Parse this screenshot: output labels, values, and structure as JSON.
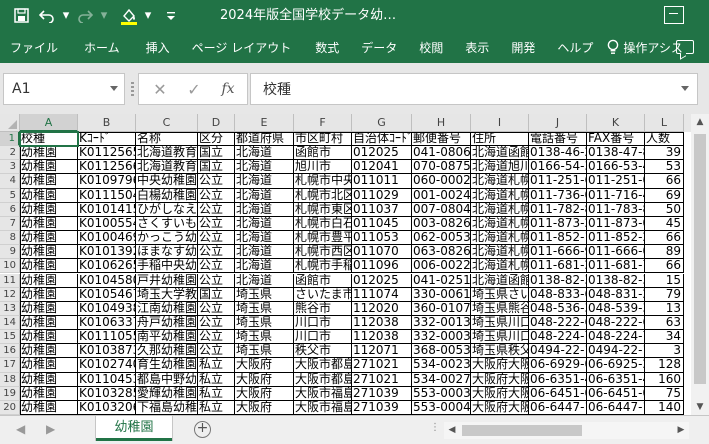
{
  "titlebar": {
    "title": "2024年版全国学校データ幼…",
    "qat": [
      "save-icon",
      "undo-icon",
      "redo-icon",
      "fill-color-icon",
      "customize-icon"
    ]
  },
  "ribbon": {
    "tabs": [
      "ファイル",
      "ホーム",
      "挿入",
      "ページ レイアウト",
      "数式",
      "データ",
      "校閲",
      "表示",
      "開発",
      "ヘルプ"
    ],
    "tell_me": "操作アシス"
  },
  "formula_bar": {
    "name_box": "A1",
    "cancel": "✕",
    "confirm": "✓",
    "fx": "fx",
    "value": "校種"
  },
  "sheet": {
    "columns": [
      "A",
      "B",
      "C",
      "D",
      "E",
      "F",
      "G",
      "H",
      "I",
      "J",
      "K",
      "L"
    ],
    "rows": [
      {
        "n": "1",
        "cells": [
          "校種",
          "Kｺｰﾄﾞ",
          "名称",
          "区分",
          "都道府県",
          "市区町村",
          "自治体ｺｰﾄﾞ",
          "郵便番号",
          "住所",
          "電話番号",
          "FAX番号",
          "人数"
        ]
      },
      {
        "n": "2",
        "cells": [
          "幼稚園",
          "K01125658",
          "北海道教育",
          "国立",
          "北海道",
          "函館市",
          "012025",
          "041-0806",
          "北海道函館",
          "0138-46-2",
          "0138-47-8",
          "39"
        ]
      },
      {
        "n": "3",
        "cells": [
          "幼稚園",
          "K01125669",
          "北海道教育",
          "国立",
          "北海道",
          "旭川市",
          "012041",
          "070-0875",
          "北海道旭川",
          "0166-54-3",
          "0166-53-4",
          "53"
        ]
      },
      {
        "n": "4",
        "cells": [
          "幼稚園",
          "K01097960",
          "中央幼稚園",
          "公立",
          "北海道",
          "札幌市中央",
          "011011",
          "060-0002",
          "北海道札幌",
          "011-251-6",
          "011-251-0",
          "66"
        ]
      },
      {
        "n": "5",
        "cells": [
          "幼稚園",
          "K01115046",
          "白楊幼稚園",
          "公立",
          "北海道",
          "札幌市北区",
          "011029",
          "001-0024",
          "北海道札幌",
          "011-736-0",
          "011-716-4",
          "69"
        ]
      },
      {
        "n": "6",
        "cells": [
          "幼稚園",
          "K01014158",
          "ひがしなえ",
          "公立",
          "北海道",
          "札幌市東区",
          "011037",
          "007-0804",
          "北海道札幌",
          "011-782-8",
          "011-783-8",
          "50"
        ]
      },
      {
        "n": "7",
        "cells": [
          "幼稚園",
          "K01005547",
          "さくすいもと",
          "公立",
          "北海道",
          "札幌市白石",
          "011045",
          "003-0826",
          "北海道札幌",
          "011-873-2",
          "011-873-0",
          "45"
        ]
      },
      {
        "n": "8",
        "cells": [
          "幼稚園",
          "K01004694",
          "かっこう幼稚",
          "公立",
          "北海道",
          "札幌市豊平",
          "011053",
          "062-0053",
          "北海道札幌",
          "011-852-1",
          "011-852-2",
          "66"
        ]
      },
      {
        "n": "9",
        "cells": [
          "幼稚園",
          "K01013928",
          "ほまなす幼",
          "公立",
          "北海道",
          "札幌市西区",
          "011070",
          "063-0826",
          "北海道札幌",
          "011-666-9",
          "011-666-0",
          "89"
        ]
      },
      {
        "n": "10",
        "cells": [
          "幼稚園",
          "K01062656",
          "手稲中央幼",
          "公立",
          "北海道",
          "札幌市手稲",
          "011096",
          "006-0022",
          "北海道札幌",
          "011-681-2",
          "011-681-7",
          "66"
        ]
      },
      {
        "n": "11",
        "cells": [
          "幼稚園",
          "K01045804",
          "戸井幼稚園",
          "公立",
          "北海道",
          "函館市",
          "012025",
          "041-0251",
          "北海道函館",
          "0138-82-3",
          "0138-82-3",
          "15"
        ]
      },
      {
        "n": "12",
        "cells": [
          "幼稚園",
          "K01054677",
          "埼玉大学教",
          "国立",
          "埼玉県",
          "さいたま市",
          "111074",
          "330-0061",
          "埼玉県さい",
          "048-833-6",
          "048-831-2",
          "79"
        ]
      },
      {
        "n": "13",
        "cells": [
          "幼稚園",
          "K01049381",
          "江南幼稚園",
          "公立",
          "埼玉県",
          "熊谷市",
          "112020",
          "360-0107",
          "埼玉県熊谷",
          "048-536-3",
          "048-539-3",
          "13"
        ]
      },
      {
        "n": "14",
        "cells": [
          "幼稚園",
          "K01063370",
          "舟戸幼稚園",
          "公立",
          "埼玉県",
          "川口市",
          "112038",
          "332-0013",
          "埼玉県川口",
          "048-222-6",
          "048-222-6",
          "63"
        ]
      },
      {
        "n": "15",
        "cells": [
          "幼稚園",
          "K01110557",
          "南平幼稚園",
          "公立",
          "埼玉県",
          "川口市",
          "112038",
          "332-0003",
          "埼玉県川口",
          "048-224-7",
          "048-224-7",
          "34"
        ]
      },
      {
        "n": "16",
        "cells": [
          "幼稚園",
          "K01038734",
          "久那幼稚園",
          "公立",
          "埼玉県",
          "秩父市",
          "112071",
          "368-0053",
          "埼玉県秩父",
          "0494-22-1",
          "0494-22-1",
          "3"
        ]
      },
      {
        "n": "17",
        "cells": [
          "幼稚園",
          "K01027408",
          "育生幼稚園",
          "私立",
          "大阪府",
          "大阪市都島",
          "271021",
          "534-0023",
          "大阪府大阪",
          "06-6929-0",
          "06-6925-2",
          "128"
        ]
      },
      {
        "n": "18",
        "cells": [
          "幼稚園",
          "K01104536",
          "都島中野幼",
          "私立",
          "大阪府",
          "大阪市都島",
          "271021",
          "534-0027",
          "大阪府大阪",
          "06-6351-4",
          "06-6351-4",
          "160"
        ]
      },
      {
        "n": "19",
        "cells": [
          "幼稚園",
          "K01032851",
          "愛輝幼稚園",
          "私立",
          "大阪府",
          "大阪市福島",
          "271039",
          "553-0003",
          "大阪府大阪",
          "06-6451-0",
          "06-6451-0",
          "75"
        ]
      },
      {
        "n": "20",
        "cells": [
          "幼稚園",
          "K01032060",
          "下福島幼稚",
          "私立",
          "大阪府",
          "大阪市福島",
          "271039",
          "553-0004",
          "大阪府大阪",
          "06-6447-1",
          "06-6447-1",
          "140"
        ]
      }
    ]
  },
  "sheet_tabs": [
    {
      "label": "幼稚園",
      "active": true
    }
  ],
  "colors": {
    "accent": "#217346",
    "header_bg": "#e6e6e6"
  }
}
